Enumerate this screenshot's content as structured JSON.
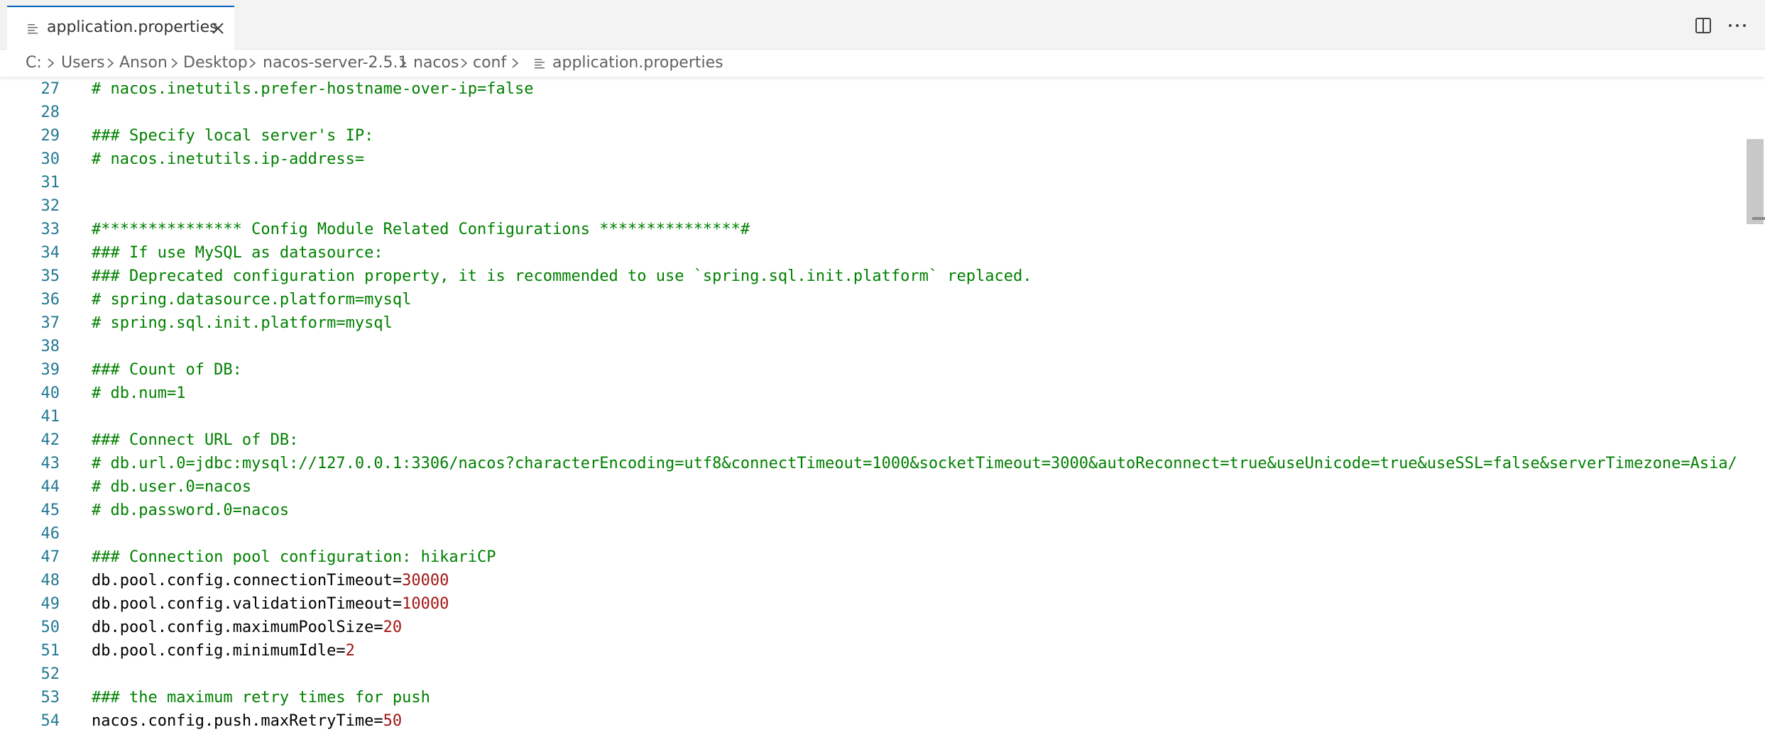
{
  "tab": {
    "label": "application.properties"
  },
  "breadcrumb": [
    "C:",
    "Users",
    "Anson",
    "Desktop",
    "nacos-server-2.5.1",
    "nacos",
    "conf",
    "application.properties"
  ],
  "colors": {
    "comment": "#008000",
    "key": "#000000",
    "number": "#a31515",
    "line_number": "#237893",
    "active_tab_border": "#005fb8"
  },
  "lines": [
    {
      "n": "27",
      "tokens": [
        {
          "t": "comment",
          "v": "# nacos.inetutils.prefer-hostname-over-ip=false"
        }
      ]
    },
    {
      "n": "28",
      "tokens": []
    },
    {
      "n": "29",
      "tokens": [
        {
          "t": "comment",
          "v": "### Specify local server's IP:"
        }
      ]
    },
    {
      "n": "30",
      "tokens": [
        {
          "t": "comment",
          "v": "# nacos.inetutils.ip-address="
        }
      ]
    },
    {
      "n": "31",
      "tokens": []
    },
    {
      "n": "32",
      "tokens": []
    },
    {
      "n": "33",
      "tokens": [
        {
          "t": "comment",
          "v": "#*************** Config Module Related Configurations ***************#"
        }
      ]
    },
    {
      "n": "34",
      "tokens": [
        {
          "t": "comment",
          "v": "### If use MySQL as datasource:"
        }
      ]
    },
    {
      "n": "35",
      "tokens": [
        {
          "t": "comment",
          "v": "### Deprecated configuration property, it is recommended to use `spring.sql.init.platform` replaced."
        }
      ]
    },
    {
      "n": "36",
      "tokens": [
        {
          "t": "comment",
          "v": "# spring.datasource.platform=mysql"
        }
      ]
    },
    {
      "n": "37",
      "tokens": [
        {
          "t": "comment",
          "v": "# spring.sql.init.platform=mysql"
        }
      ]
    },
    {
      "n": "38",
      "tokens": []
    },
    {
      "n": "39",
      "tokens": [
        {
          "t": "comment",
          "v": "### Count of DB:"
        }
      ]
    },
    {
      "n": "40",
      "tokens": [
        {
          "t": "comment",
          "v": "# db.num=1"
        }
      ]
    },
    {
      "n": "41",
      "tokens": []
    },
    {
      "n": "42",
      "tokens": [
        {
          "t": "comment",
          "v": "### Connect URL of DB:"
        }
      ]
    },
    {
      "n": "43",
      "tokens": [
        {
          "t": "comment",
          "v": "# db.url.0=jdbc:mysql://127.0.0.1:3306/nacos?characterEncoding=utf8&connectTimeout=1000&socketTimeout=3000&autoReconnect=true&useUnicode=true&useSSL=false&serverTimezone=Asia/"
        }
      ]
    },
    {
      "n": "44",
      "tokens": [
        {
          "t": "comment",
          "v": "# db.user.0=nacos"
        }
      ]
    },
    {
      "n": "45",
      "tokens": [
        {
          "t": "comment",
          "v": "# db.password.0=nacos"
        }
      ]
    },
    {
      "n": "46",
      "tokens": []
    },
    {
      "n": "47",
      "tokens": [
        {
          "t": "comment",
          "v": "### Connection pool configuration: hikariCP"
        }
      ]
    },
    {
      "n": "48",
      "tokens": [
        {
          "t": "key",
          "v": "db.pool.config.connectionTimeout="
        },
        {
          "t": "num",
          "v": "30000"
        }
      ]
    },
    {
      "n": "49",
      "tokens": [
        {
          "t": "key",
          "v": "db.pool.config.validationTimeout="
        },
        {
          "t": "num",
          "v": "10000"
        }
      ]
    },
    {
      "n": "50",
      "tokens": [
        {
          "t": "key",
          "v": "db.pool.config.maximumPoolSize="
        },
        {
          "t": "num",
          "v": "20"
        }
      ]
    },
    {
      "n": "51",
      "tokens": [
        {
          "t": "key",
          "v": "db.pool.config.minimumIdle="
        },
        {
          "t": "num",
          "v": "2"
        }
      ]
    },
    {
      "n": "52",
      "tokens": []
    },
    {
      "n": "53",
      "tokens": [
        {
          "t": "comment",
          "v": "### the maximum retry times for push"
        }
      ]
    },
    {
      "n": "54",
      "tokens": [
        {
          "t": "key",
          "v": "nacos.config.push.maxRetryTime="
        },
        {
          "t": "num",
          "v": "50"
        }
      ]
    }
  ]
}
